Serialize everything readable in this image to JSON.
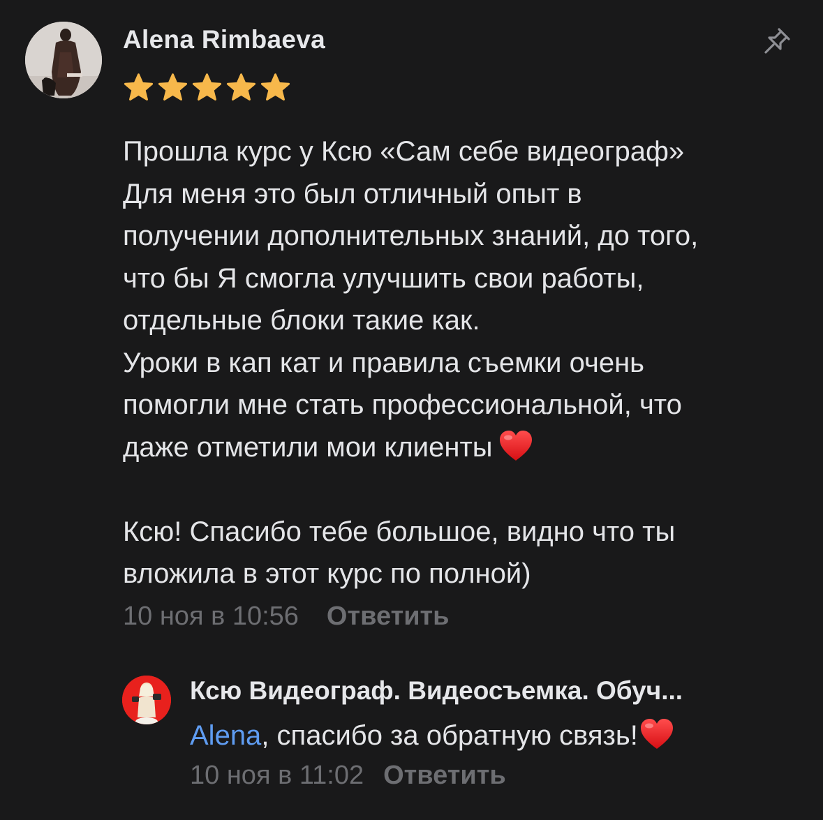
{
  "comment": {
    "author": "Alena Rimbaeva",
    "rating": 5,
    "rating_color": "#f7b84b",
    "pin_icon": "pin-icon",
    "body_lines": [
      "Прошла курс у Ксю «Сам себе видеограф»",
      "Для меня это был отличный опыт в",
      "получении дополнительных знаний, до того,",
      "что бы Я смогла улучшить свои работы,",
      "отдельные блоки такие как.",
      "Уроки в кап кат и правила съемки очень",
      "помогли мне стать профессиональной, что",
      "даже отметили мои клиенты"
    ],
    "body_lines_2": [
      "Ксю! Спасибо тебе большое, видно что ты",
      "вложила в этот курс по полной)"
    ],
    "emoji": "heart-emoji",
    "date": "10 ноя в 10:56",
    "reply_label": "Ответить"
  },
  "reply": {
    "author": "Ксю Видеограф. Видеосъемка. Обуч...",
    "mention": "Alena",
    "text": ", спасибо за обратную связь!",
    "emoji": "heart-emoji",
    "date": "10 ноя в 11:02",
    "reply_label": "Ответить",
    "mention_color": "#5f9cf1",
    "avatar_bg": "#e8211d"
  }
}
